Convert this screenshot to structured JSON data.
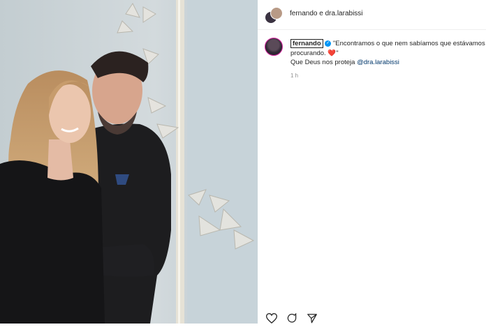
{
  "header": {
    "names": "fernando e dra.larabissi"
  },
  "post": {
    "username": "fernando",
    "caption_line1": "\"Encontramos o que nem sabíamos que estávamos",
    "caption_line2_text": "procurando.",
    "caption_heart": "❤️",
    "caption_line2_quote": "\"",
    "caption_line3_text": "Que Deus nos proteja",
    "mention": "@dra.larabissi",
    "time": "1 h"
  },
  "icons": [
    "verified-icon",
    "heart-icon",
    "comment-icon",
    "share-icon"
  ],
  "colors": {
    "verified": "#0095f6",
    "mention": "#00376b",
    "text": "#262626",
    "muted": "#8e8e8e"
  }
}
